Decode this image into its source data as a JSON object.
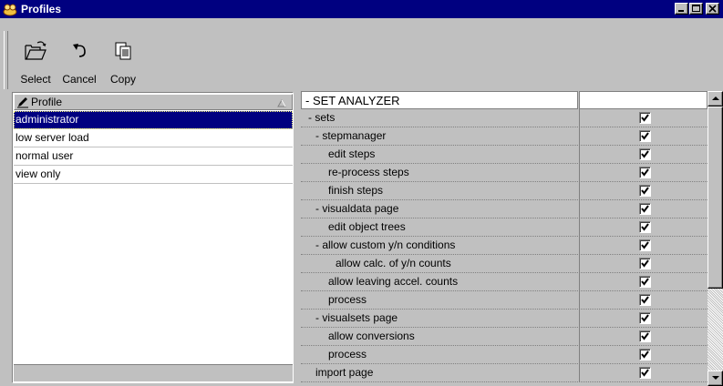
{
  "window": {
    "title": "Profiles"
  },
  "toolbar": {
    "select_label": "Select",
    "cancel_label": "Cancel",
    "copy_label": "Copy"
  },
  "profiles": {
    "header": "Profile",
    "items": [
      {
        "label": "administrator",
        "selected": true
      },
      {
        "label": "low server load",
        "selected": false
      },
      {
        "label": "normal user",
        "selected": false
      },
      {
        "label": "view only",
        "selected": false
      }
    ]
  },
  "permissions": {
    "items": [
      {
        "label": "- SET ANALYZER",
        "level": 0,
        "checked": null
      },
      {
        "label": "- sets",
        "level": 1,
        "checked": true
      },
      {
        "label": "- stepmanager",
        "level": 2,
        "checked": true
      },
      {
        "label": "edit steps",
        "level": 3,
        "checked": true
      },
      {
        "label": "re-process steps",
        "level": 3,
        "checked": true
      },
      {
        "label": "finish steps",
        "level": 3,
        "checked": true
      },
      {
        "label": "- visualdata page",
        "level": 2,
        "checked": true
      },
      {
        "label": "edit object trees",
        "level": 3,
        "checked": true
      },
      {
        "label": "- allow custom y/n conditions",
        "level": 2,
        "checked": true
      },
      {
        "label": "allow calc. of y/n counts",
        "level": 4,
        "checked": true
      },
      {
        "label": "allow leaving accel. counts",
        "level": 3,
        "checked": true
      },
      {
        "label": "process",
        "level": 3,
        "checked": true
      },
      {
        "label": "- visualsets page",
        "level": 2,
        "checked": true
      },
      {
        "label": "allow conversions",
        "level": 3,
        "checked": true
      },
      {
        "label": "process",
        "level": 3,
        "checked": true
      },
      {
        "label": "import page",
        "level": 2,
        "checked": true
      }
    ]
  },
  "icons": {
    "window": "profiles-window-icon",
    "select": "open-folder-icon",
    "cancel": "undo-arrow-icon",
    "copy": "copy-document-icon",
    "header": "pencil-icon",
    "sort": "sort-triangle-icon"
  },
  "colors": {
    "titlebar": "#000080",
    "face": "#c0c0c0",
    "selection": "#000080"
  }
}
